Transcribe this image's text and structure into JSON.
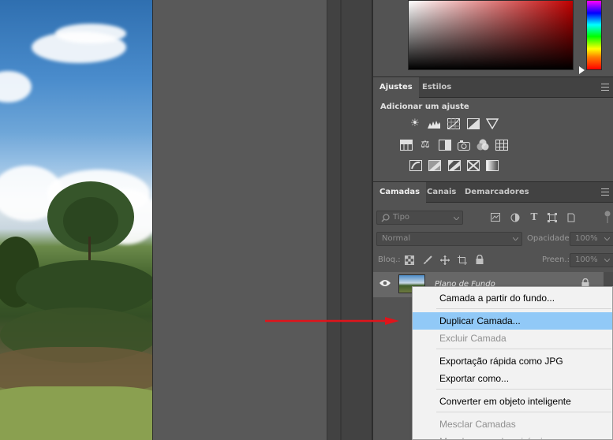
{
  "colors": {
    "accent_arrow": "#e0141b",
    "menu_highlight": "#91c9f7",
    "panel_bg": "#535353",
    "tab_bar": "#424242"
  },
  "adjustments_panel": {
    "tabs": [
      {
        "label": "Ajustes",
        "active": true
      },
      {
        "label": "Estilos",
        "active": false
      }
    ],
    "title": "Adicionar um ajuste",
    "icons": [
      "brightness-contrast-icon",
      "levels-icon",
      "curves-icon",
      "exposure-icon",
      "vibrance-icon",
      "hue-saturation-icon",
      "color-balance-icon",
      "black-white-icon",
      "photo-filter-icon",
      "channel-mixer-icon",
      "color-lookup-icon",
      "invert-icon",
      "posterize-icon",
      "threshold-icon",
      "selective-color-icon",
      "gradient-map-icon"
    ]
  },
  "layers_panel": {
    "tabs": [
      {
        "label": "Camadas",
        "active": true
      },
      {
        "label": "Canais",
        "active": false
      },
      {
        "label": "Demarcadores",
        "active": false
      }
    ],
    "filter_placeholder": "Tipo",
    "blend_mode": "Normal",
    "opacity_label": "Opacidade:",
    "opacity_value": "100%",
    "lock_label": "Bloq.:",
    "fill_label": "Preen.:",
    "fill_value": "100%",
    "layer": {
      "name": "Plano de Fundo"
    }
  },
  "context_menu": {
    "items": [
      {
        "label": "Camada a partir do fundo...",
        "disabled": false,
        "highlighted": false
      },
      {
        "label": "Duplicar Camada...",
        "disabled": false,
        "highlighted": true
      },
      {
        "label": "Excluir Camada",
        "disabled": true,
        "highlighted": false
      },
      {
        "label": "Exportação rápida como JPG",
        "disabled": false,
        "highlighted": false
      },
      {
        "label": "Exportar como...",
        "disabled": false,
        "highlighted": false
      },
      {
        "label": "Converter em objeto inteligente",
        "disabled": false,
        "highlighted": false
      },
      {
        "label": "Mesclar Camadas",
        "disabled": true,
        "highlighted": false
      },
      {
        "label": "Mesclar camadas visíveis",
        "disabled": true,
        "highlighted": false
      }
    ]
  }
}
